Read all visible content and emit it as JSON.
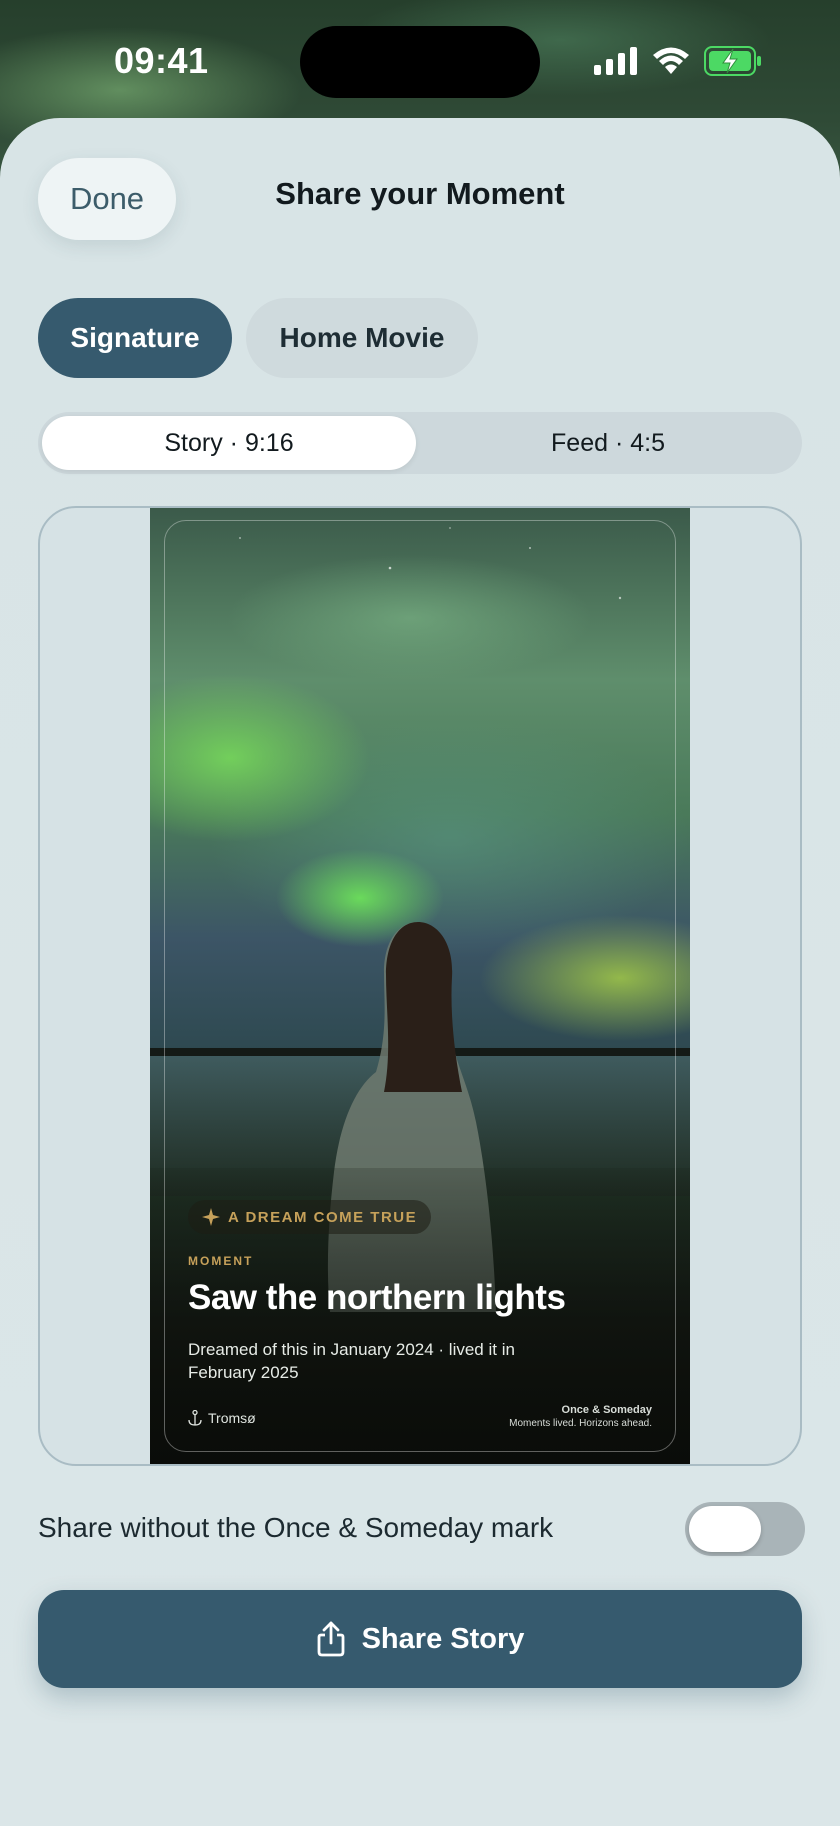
{
  "status_bar": {
    "time": "09:41"
  },
  "header": {
    "done_label": "Done",
    "title": "Share your Moment"
  },
  "style_chips": {
    "signature": "Signature",
    "home_movie": "Home Movie"
  },
  "format_tabs": {
    "story": "Story · 9:16",
    "feed": "Feed · 4:5",
    "selected": "story"
  },
  "preview": {
    "badge": "A DREAM COME TRUE",
    "label": "MOMENT",
    "title": "Saw the northern lights",
    "description": "Dreamed of this in January 2024 · lived it in February 2025",
    "location": "Tromsø",
    "brand_name": "Once & Someday",
    "brand_tagline": "Moments lived. Horizons ahead."
  },
  "toggle": {
    "label": "Share without the Once & Someday mark",
    "on": false
  },
  "share_button": {
    "label": "Share Story"
  },
  "colors": {
    "accent": "#365a6e",
    "gold": "#c6a15a",
    "sheet": "#dbe6e8",
    "battery": "#4cd964"
  }
}
